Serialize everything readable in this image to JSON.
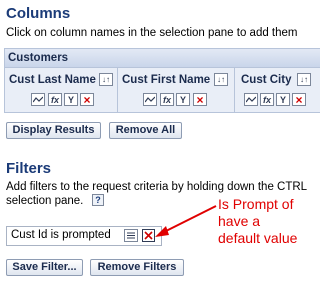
{
  "columns": {
    "title": "Columns",
    "description": "Click on column names in the selection pane to add them",
    "table_name": "Customers",
    "items": [
      {
        "label": "Cust Last Name"
      },
      {
        "label": "Cust First Name"
      },
      {
        "label": "Cust City"
      }
    ],
    "sort_glyph": "↓↑",
    "fx_glyph": "fx",
    "filter_glyph": "Y",
    "remove_glyph": "×",
    "display_results_label": "Display Results",
    "remove_all_label": "Remove All"
  },
  "filters": {
    "title": "Filters",
    "description_line1": "Add filters to the request criteria by holding down the CTRL",
    "description_line2": "selection pane.",
    "help_glyph": "?",
    "items": [
      {
        "label": "Cust Id is prompted"
      }
    ],
    "save_filter_label": "Save Filter...",
    "remove_filters_label": "Remove Filters"
  },
  "annotation": {
    "line1": "Is Prompt of",
    "line2": "have a",
    "line3": "default value",
    "color": "#e00000"
  }
}
